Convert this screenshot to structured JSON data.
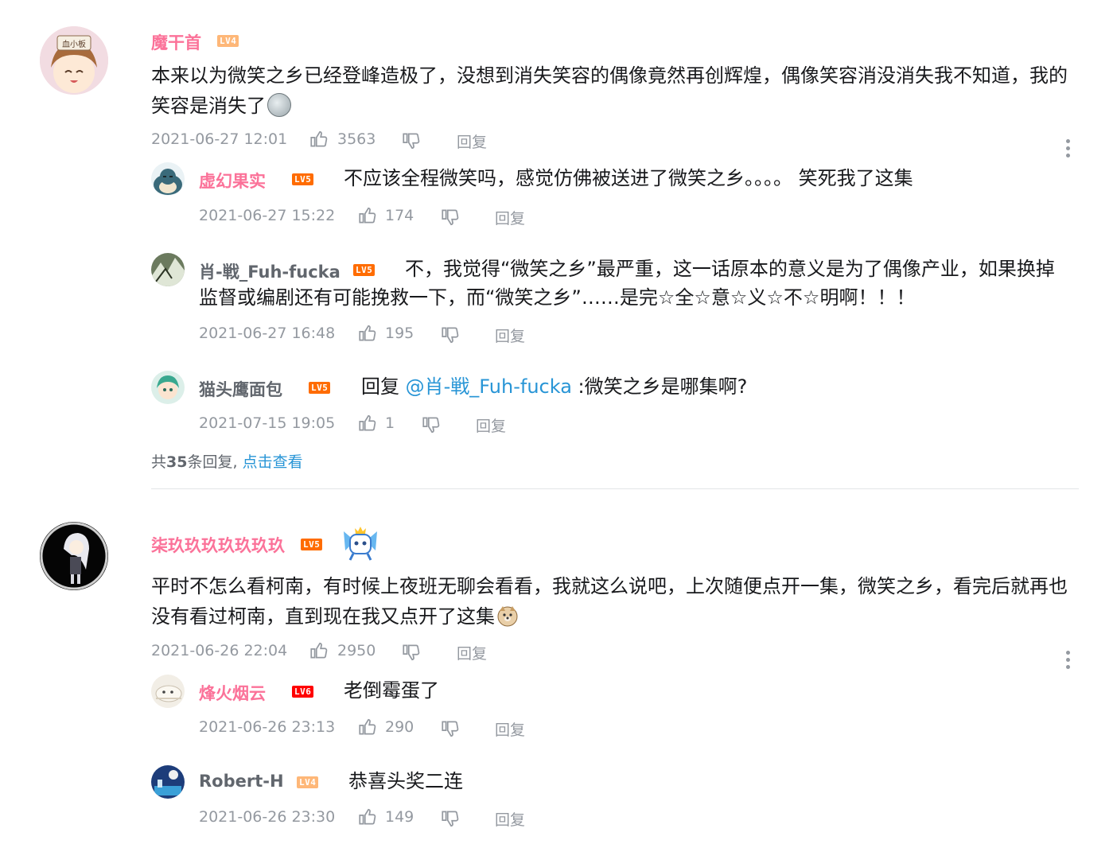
{
  "comments": [
    {
      "user": "魔干首",
      "level": "LV4",
      "text": "本来以为微笑之乡已经登峰造极了，没想到消失笑容的偶像竟然再创辉煌，偶像笑容消没消失我不知道，我的笑容是消失了",
      "time": "2021-06-27 12:01",
      "likes": "3563",
      "reply_label": "回复",
      "replies": [
        {
          "user": "虚幻果实",
          "level": "LV5",
          "text": "不应该全程微笑吗，感觉仿佛被送进了微笑之乡。。。。 笑死我了这集",
          "time": "2021-06-27 15:22",
          "likes": "174",
          "reply_label": "回复"
        },
        {
          "user": "肖-戦_Fuh-fucka",
          "level": "LV5",
          "text_line1": "不，我觉得“微笑之乡”最严重，这一话原本的意义是为了偶像产业，如果换掉",
          "text_line2": "监督或编剧还有可能挽救一下，而“微笑之乡”……是完☆全☆意☆义☆不☆明啊！！！",
          "time": "2021-06-27 16:48",
          "likes": "195",
          "reply_label": "回复"
        },
        {
          "user": "猫头鹰面包",
          "level": "LV5",
          "text_prefix": "回复 ",
          "mention": "@肖-戦_Fuh-fucka",
          "text_suffix": " :微笑之乡是哪集啊?",
          "time": "2021-07-15 19:05",
          "likes": "1",
          "reply_label": "回复"
        }
      ],
      "summary": {
        "prefix": "共",
        "count": "35",
        "middle": "条回复,",
        "link": "点击查看"
      }
    },
    {
      "user": "柒玖玖玖玖玖玖玖",
      "level": "LV5",
      "text": "平时不怎么看柯南，有时候上夜班无聊会看看，我就这么说吧，上次随便点开一集，微笑之乡，看完后就再也没有看过柯南，直到现在我又点开了这集",
      "time": "2021-06-26 22:04",
      "likes": "2950",
      "reply_label": "回复",
      "replies": [
        {
          "user": "烽火烟云",
          "level": "LV6",
          "text": "老倒霉蛋了",
          "time": "2021-06-26 23:13",
          "likes": "290",
          "reply_label": "回复"
        },
        {
          "user": "Robert-H",
          "level": "LV4",
          "text": "恭喜头奖二连",
          "time": "2021-06-26 23:30",
          "likes": "149",
          "reply_label": "回复"
        }
      ]
    }
  ],
  "colors": {
    "vip_pink": "#fb7299",
    "link_blue": "#2895d6",
    "meta_gray": "#9499a0"
  }
}
